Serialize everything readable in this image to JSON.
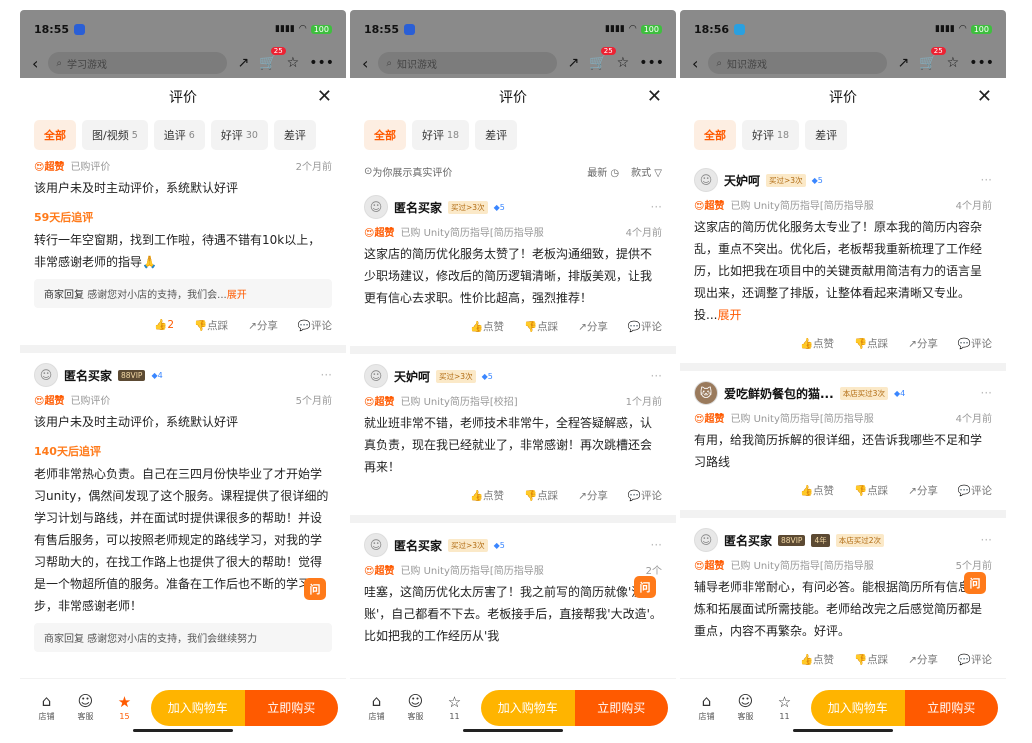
{
  "phones": [
    {
      "status_time": "18:55",
      "search_placeholder": "学习游戏",
      "cart_count": "25",
      "sheet_title": "评价",
      "tabs": [
        {
          "label": "全部",
          "count": ""
        },
        {
          "label": "图/视频",
          "count": "5"
        },
        {
          "label": "追评",
          "count": "6"
        },
        {
          "label": "好评",
          "count": "30"
        },
        {
          "label": "差评",
          "count": ""
        }
      ],
      "top_partial": {
        "tag": "超赞",
        "bought": "已购评价",
        "time": "2个月前"
      },
      "reviews": [
        {
          "text": "该用户未及时主动评价，系统默认好评",
          "followup_label": "59天后追评",
          "followup_text": "转行一年空窗期，找到工作啦，待遇不错有10k以上，非常感谢老师的指导🙏",
          "reply_label": "商家回复",
          "reply_text": "感谢您对小店的支持，我们会...",
          "reply_more": "展开",
          "likes": "2",
          "a_dislike": "点踩",
          "a_share": "分享",
          "a_comment": "评论"
        },
        {
          "user": "匿名买家",
          "badge": "88VIP",
          "diamond": "4",
          "tag": "超赞",
          "bought": "已购评价",
          "time": "5个月前",
          "text": "该用户未及时主动评价，系统默认好评",
          "followup_label": "140天后追评",
          "followup_text": "老师非常热心负责。自己在三四月份快毕业了才开始学习unity，偶然间发现了这个服务。课程提供了很详细的学习计划与路线，并在面试时提供课很多的帮助！并设有售后服务，可以按照老师规定的路线学习，对我的学习帮助大的，在找工作路上也提供了很大的帮助！觉得是一个物超所值的服务。准备在工作后也不断的学习进步，非常感谢老师！",
          "reply_text": "商家回复 感谢您对小店的支持，我们会继续努力"
        }
      ],
      "bottom": {
        "shop": "店铺",
        "service": "客服",
        "fav_count": "15",
        "cart": "加入购物车",
        "buy": "立即购买"
      }
    },
    {
      "status_time": "18:55",
      "search_placeholder": "知识游戏",
      "cart_count": "25",
      "sheet_title": "评价",
      "tabs": [
        {
          "label": "全部",
          "count": ""
        },
        {
          "label": "好评",
          "count": "18"
        },
        {
          "label": "差评",
          "count": ""
        }
      ],
      "trust": "为你展示真实评价",
      "sort_latest": "最新",
      "sort_style": "款式",
      "reviews": [
        {
          "user": "匿名买家",
          "badge": "买过>3次",
          "diamond": "5",
          "tag": "超赞",
          "bought": "已购 Unity简历指导[简历指导服",
          "time": "4个月前",
          "text": "这家店的简历优化服务太赞了！老板沟通细致，提供不少职场建议，修改后的简历逻辑清晰，排版美观，让我更有信心去求职。性价比超高，强烈推荐！",
          "a_like": "点赞",
          "a_dislike": "点踩",
          "a_share": "分享",
          "a_comment": "评论"
        },
        {
          "user": "天妒呵",
          "badge": "买过>3次",
          "diamond": "5",
          "tag": "超赞",
          "bought": "已购 Unity简历指导[校招]",
          "time": "1个月前",
          "text": "就业班非常不错，老师技术非常牛，全程答疑解惑，认真负责，现在我已经就业了，非常感谢！再次跳槽还会再来！"
        },
        {
          "user": "匿名买家",
          "badge": "买过>3次",
          "diamond": "5",
          "tag": "超赞",
          "bought": "已购 Unity简历指导[简历指导服",
          "time": "2个",
          "text": "哇塞，这简历优化太厉害了！我之前写的简历就像'流水账'，自己都看不下去。老板接手后，直接帮我'大改造'。比如把我的工作经历从'我"
        }
      ],
      "bottom": {
        "shop": "店铺",
        "service": "客服",
        "fav_count": "11",
        "cart": "加入购物车",
        "buy": "立即购买"
      }
    },
    {
      "status_time": "18:56",
      "search_placeholder": "知识游戏",
      "cart_count": "25",
      "sheet_title": "评价",
      "tabs": [
        {
          "label": "全部",
          "count": ""
        },
        {
          "label": "好评",
          "count": "18"
        },
        {
          "label": "差评",
          "count": ""
        }
      ],
      "reviews": [
        {
          "user": "天妒呵",
          "badge": "买过>3次",
          "diamond": "5",
          "tag": "超赞",
          "bought": "已购 Unity简历指导[简历指导服",
          "time": "4个月前",
          "text": "这家店的简历优化服务太专业了！原本我的简历内容杂乱，重点不突出。优化后，老板帮我重新梳理了工作经历，比如把我在项目中的关键贡献用简洁有力的语言呈现出来，还调整了排版，让整体看起来清晰又专业。投...",
          "more": "展开"
        },
        {
          "user": "爱吃鲜奶餐包的猫...",
          "badge": "本店买过3次",
          "diamond": "4",
          "tag": "超赞",
          "bought": "已购 Unity简历指导[简历指导服",
          "time": "4个月前",
          "text": "有用，给我简历拆解的很详细，还告诉我哪些不足和学习路线"
        },
        {
          "user": "匿名买家",
          "badge": "88VIP",
          "badge2": "4年",
          "badge3": "本店买过2次",
          "tag": "超赞",
          "bought": "已购 Unity简历指导[简历指导服",
          "time": "5个月前",
          "text": "辅导老师非常耐心，有问必答。能根据简历所有信息提炼和拓展面试所需技能。老师给改完之后感觉简历都是重点，内容不再繁杂。好评。"
        }
      ],
      "bottom": {
        "shop": "店铺",
        "service": "客服",
        "fav_count": "11",
        "cart": "加入购物车",
        "buy": "立即购买"
      }
    }
  ],
  "ask_label": "问",
  "colors": {
    "accent": "#ff5a00",
    "cart": "#ffb400",
    "overlay": "#8a8a8a"
  }
}
